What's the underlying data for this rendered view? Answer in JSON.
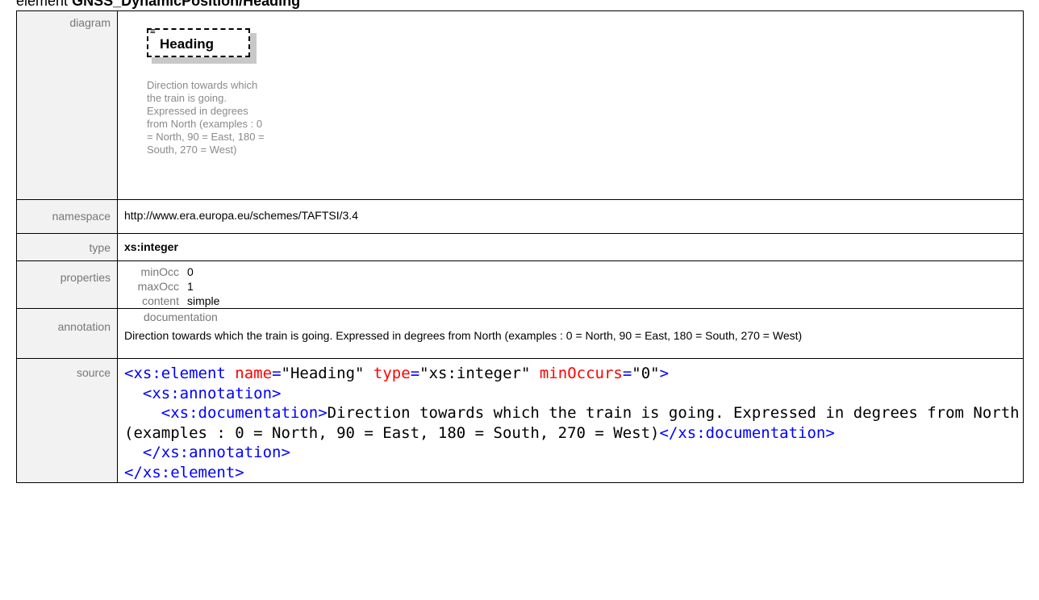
{
  "caption": {
    "prefix": "element",
    "name": "GNSS_DynamicPosition/Heading"
  },
  "rows": {
    "diagram": {
      "label": "diagram",
      "element_name": "Heading",
      "element_doc": "Direction towards which the train is going. Expressed in degrees from North (examples : 0 = North, 90 = East, 180 = South, 270 = West)"
    },
    "namespace": {
      "label": "namespace",
      "value": "http://www.era.europa.eu/schemes/TAFTSI/3.4"
    },
    "type": {
      "label": "type",
      "value": "xs:integer"
    },
    "properties": {
      "label": "properties",
      "items": [
        {
          "key": "minOcc",
          "value": "0"
        },
        {
          "key": "maxOcc",
          "value": "1"
        },
        {
          "key": "content",
          "value": "simple"
        }
      ]
    },
    "annotation": {
      "label": "annotation",
      "heading": "documentation",
      "text": "Direction towards which the train is going. Expressed in degrees from North (examples : 0 = North, 90 = East, 180 = South, 270 = West)"
    },
    "source": {
      "label": "source",
      "line1_tag_open": "<xs:element",
      "line1_attr_name": "name",
      "line1_eq1": "=",
      "line1_val_name": "\"Heading\"",
      "line1_attr_type": "type",
      "line1_eq2": "=",
      "line1_val_type": "\"xs:integer\"",
      "line1_attr_min": "minOccurs",
      "line1_eq3": "=",
      "line1_val_min": "\"0\"",
      "line1_close": ">",
      "line2": "<xs:annotation>",
      "line3_open": "<xs:documentation>",
      "doc_text": "Direction towards which the train is going. Expressed in degrees from North (examples : 0 = North, 90 = East, 180 = South, 270 = West)",
      "line3_close": "</xs:documentation>",
      "line4": "</xs:annotation>",
      "line5": "</xs:element>"
    }
  }
}
